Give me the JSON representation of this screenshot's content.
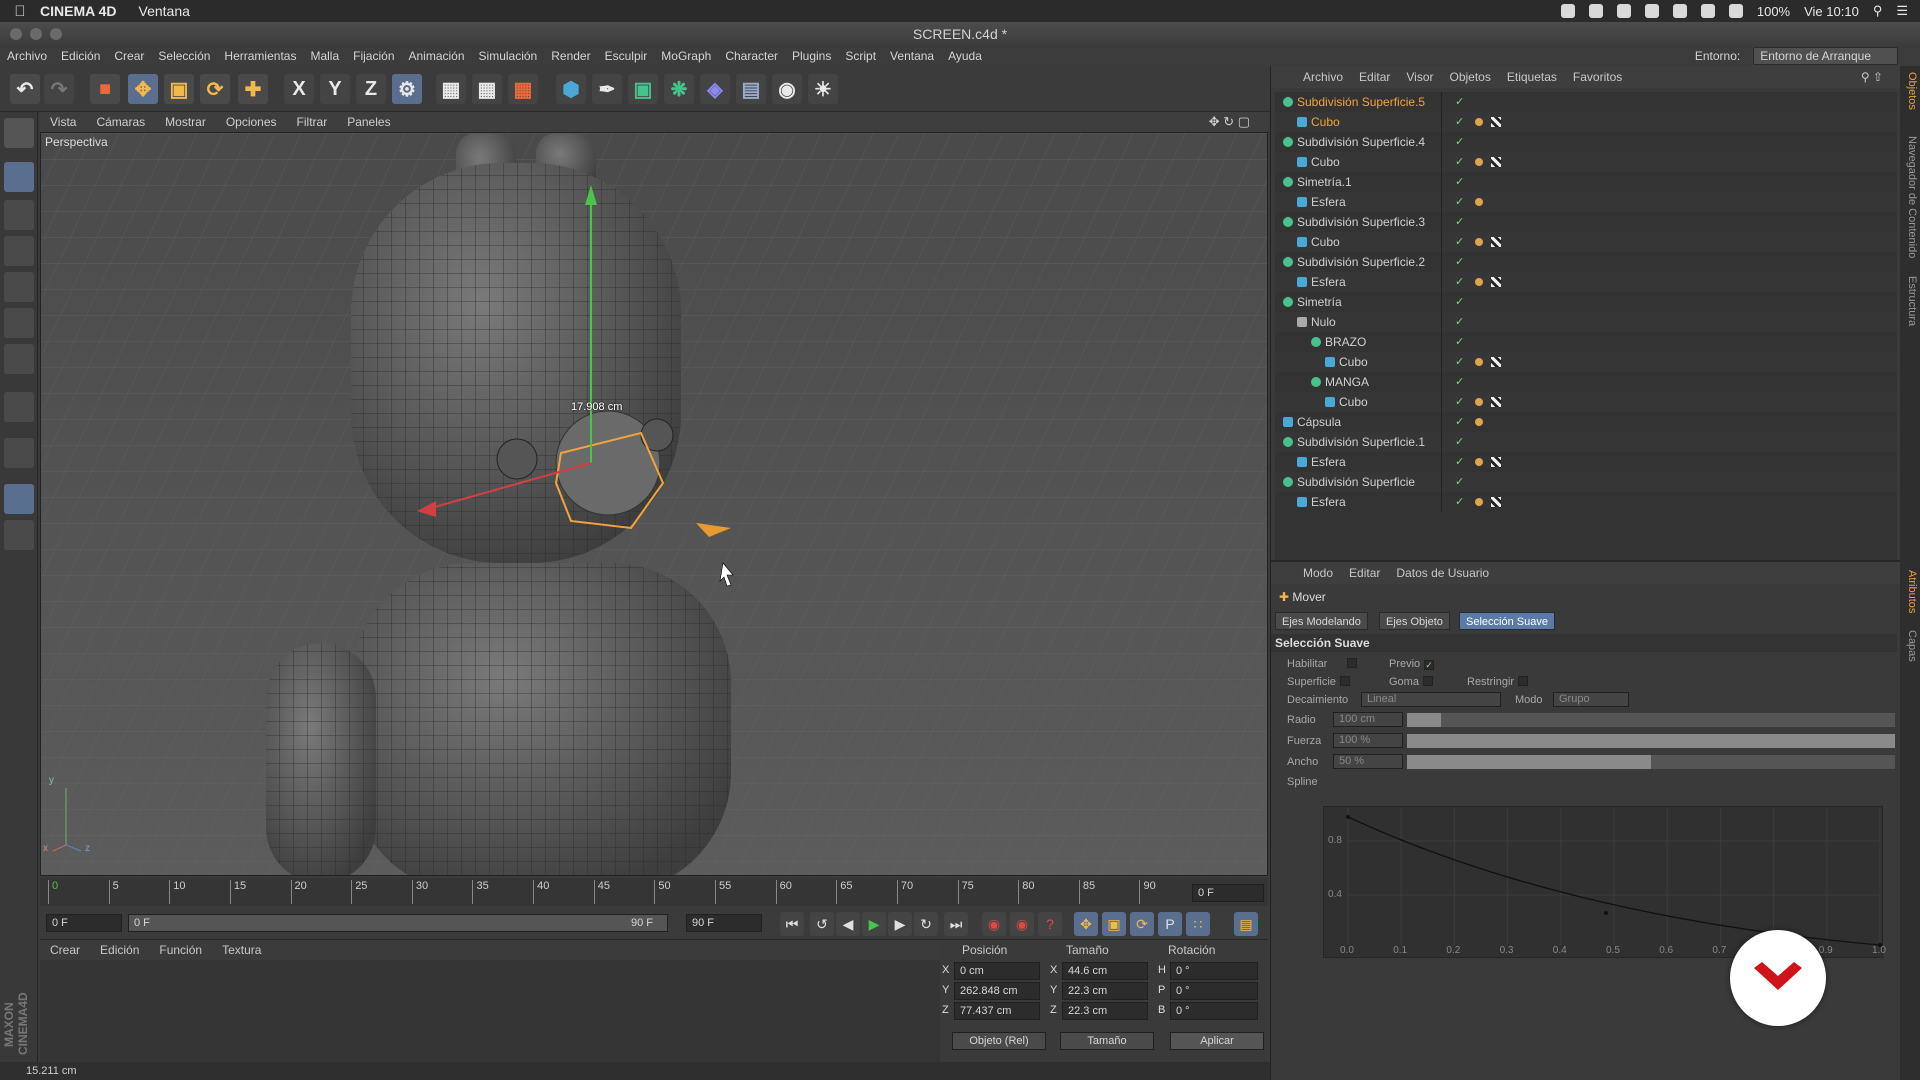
{
  "mac_menubar": {
    "app_name": "CINEMA 4D",
    "menu_window": "Ventana",
    "battery": "100%",
    "clock": "Vie 10:10"
  },
  "window": {
    "title": "SCREEN.c4d *"
  },
  "main_menu": {
    "items": [
      "Archivo",
      "Edición",
      "Crear",
      "Selección",
      "Herramientas",
      "Malla",
      "Fijación",
      "Animación",
      "Simulación",
      "Render",
      "Esculpir",
      "MoGraph",
      "Character",
      "Plugins",
      "Script",
      "Ventana",
      "Ayuda"
    ],
    "entorno_label": "Entorno:",
    "entorno_value": "Entorno de Arranque"
  },
  "toolbar": {
    "axis_x": "X",
    "axis_y": "Y",
    "axis_z": "Z"
  },
  "viewport": {
    "menu": [
      "Vista",
      "Cámaras",
      "Mostrar",
      "Opciones",
      "Filtrar",
      "Paneles"
    ],
    "label": "Perspectiva",
    "measure": "17.908 cm",
    "axis_y": "y",
    "axis_x": "x",
    "axis_z": "z"
  },
  "timeline": {
    "ticks": [
      "0",
      "5",
      "10",
      "15",
      "20",
      "25",
      "30",
      "35",
      "40",
      "45",
      "50",
      "55",
      "60",
      "65",
      "70",
      "75",
      "80",
      "85",
      "90"
    ],
    "current_frame": "0 F",
    "start_frame": "0 F",
    "range_start": "0 F",
    "range_end": "90 F",
    "end_frame": "90 F"
  },
  "material_manager": {
    "menu": [
      "Crear",
      "Edición",
      "Función",
      "Textura"
    ]
  },
  "coordinates": {
    "header_pos": "Posición",
    "header_size": "Tamaño",
    "header_rot": "Rotación",
    "rows": [
      {
        "axis": "X",
        "pos": "0 cm",
        "saxis": "X",
        "size": "44.6 cm",
        "raxis": "H",
        "rot": "0 °"
      },
      {
        "axis": "Y",
        "pos": "262.848 cm",
        "saxis": "Y",
        "size": "22.3 cm",
        "raxis": "P",
        "rot": "0 °"
      },
      {
        "axis": "Z",
        "pos": "77.437 cm",
        "saxis": "Z",
        "size": "22.3 cm",
        "raxis": "B",
        "rot": "0 °"
      }
    ],
    "mode_select": "Objeto (Rel)",
    "size_select": "Tamaño",
    "apply_button": "Aplicar"
  },
  "status": {
    "text": "15.211 cm"
  },
  "object_manager": {
    "menu": [
      "Archivo",
      "Editar",
      "Visor",
      "Objetos",
      "Etiquetas",
      "Favoritos"
    ],
    "rows": [
      {
        "name": "Subdivisión Superficie.5",
        "indent": 0,
        "kind": "gen",
        "highlight": true,
        "tags": 0
      },
      {
        "name": "Cubo",
        "indent": 1,
        "kind": "cube",
        "highlight": true,
        "tags": 2
      },
      {
        "name": "Subdivisión Superficie.4",
        "indent": 0,
        "kind": "gen",
        "highlight": false,
        "tags": 0
      },
      {
        "name": "Cubo",
        "indent": 1,
        "kind": "cube",
        "highlight": false,
        "tags": 2
      },
      {
        "name": "Simetría.1",
        "indent": 0,
        "kind": "gen",
        "highlight": false,
        "tags": 0
      },
      {
        "name": "Esfera",
        "indent": 1,
        "kind": "cube",
        "highlight": false,
        "tags": 1
      },
      {
        "name": "Subdivisión Superficie.3",
        "indent": 0,
        "kind": "gen",
        "highlight": false,
        "tags": 0
      },
      {
        "name": "Cubo",
        "indent": 1,
        "kind": "cube",
        "highlight": false,
        "tags": 2
      },
      {
        "name": "Subdivisión Superficie.2",
        "indent": 0,
        "kind": "gen",
        "highlight": false,
        "tags": 0
      },
      {
        "name": "Esfera",
        "indent": 1,
        "kind": "cube",
        "highlight": false,
        "tags": 2
      },
      {
        "name": "Simetría",
        "indent": 0,
        "kind": "gen",
        "highlight": false,
        "tags": 0
      },
      {
        "name": "Nulo",
        "indent": 1,
        "kind": "null",
        "highlight": false,
        "tags": 0
      },
      {
        "name": "BRAZO",
        "indent": 2,
        "kind": "gen",
        "highlight": false,
        "tags": 0
      },
      {
        "name": "Cubo",
        "indent": 3,
        "kind": "cube",
        "highlight": false,
        "tags": 2
      },
      {
        "name": "MANGA",
        "indent": 2,
        "kind": "gen",
        "highlight": false,
        "tags": 0
      },
      {
        "name": "Cubo",
        "indent": 3,
        "kind": "cube",
        "highlight": false,
        "tags": 2
      },
      {
        "name": "Cápsula",
        "indent": 0,
        "kind": "cube",
        "highlight": false,
        "tags": 1
      },
      {
        "name": "Subdivisión Superficie.1",
        "indent": 0,
        "kind": "gen",
        "highlight": false,
        "tags": 0
      },
      {
        "name": "Esfera",
        "indent": 1,
        "kind": "cube",
        "highlight": false,
        "tags": 2
      },
      {
        "name": "Subdivisión Superficie",
        "indent": 0,
        "kind": "gen",
        "highlight": false,
        "tags": 0
      },
      {
        "name": "Esfera",
        "indent": 1,
        "kind": "cube",
        "highlight": false,
        "tags": 2
      }
    ]
  },
  "attributes": {
    "menu": [
      "Modo",
      "Editar",
      "Datos de Usuario"
    ],
    "tool_name": "Mover",
    "tabs": [
      "Ejes Modelando",
      "Ejes Objeto",
      "Selección Suave"
    ],
    "selected_tab": "Selección Suave",
    "section": "Selección Suave",
    "habilitar": "Habilitar",
    "previo": "Previo",
    "superficie": "Superficie",
    "goma": "Goma",
    "restringir": "Restringir",
    "decaimiento": "Decaimiento",
    "decaimiento_value": "Lineal",
    "modo": "Modo",
    "modo_value": "Grupo",
    "radio": "Radio",
    "radio_value": "100 cm",
    "radio_fraction": 0.07,
    "fuerza": "Fuerza",
    "fuerza_value": "100 %",
    "fuerza_fraction": 1.0,
    "ancho": "Ancho",
    "ancho_value": "50 %",
    "ancho_fraction": 0.5,
    "spline": "Spline",
    "spline_y": [
      "0.8",
      "0.4"
    ],
    "spline_x": [
      "0.0",
      "0.1",
      "0.2",
      "0.3",
      "0.4",
      "0.5",
      "0.6",
      "0.7",
      "0.8",
      "0.9",
      "1.0"
    ]
  },
  "side_tabs": [
    "Objetos",
    "Navegador de Contenido",
    "Estructura",
    "Atributos",
    "Capas"
  ]
}
